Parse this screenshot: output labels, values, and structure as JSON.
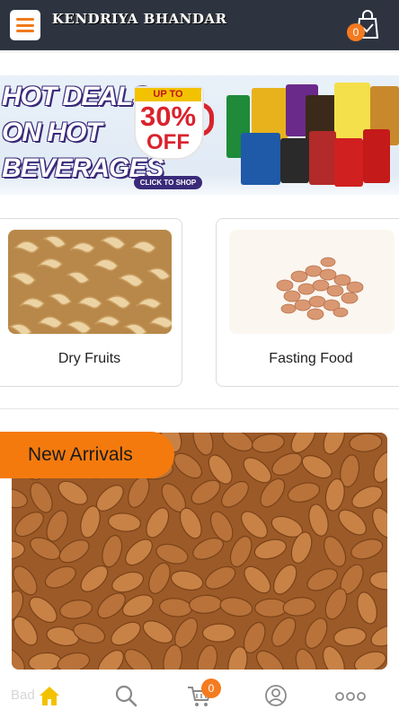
{
  "header": {
    "brand": "KENDRIYA BHANDAR",
    "cart_count": "0"
  },
  "banner": {
    "headline": [
      "HOT DEALS",
      "ON HOT",
      "BEVERAGES"
    ],
    "upto": "UP TO",
    "percent": "30%",
    "off": "OFF",
    "cta": "CLICK TO SHOP"
  },
  "categories": [
    {
      "label": "Dry Fruits"
    },
    {
      "label": "Fasting Food"
    }
  ],
  "new_arrivals": {
    "label": "New Arrivals"
  },
  "bottom_nav": {
    "ghost_text": "Bad",
    "cart_count": "0",
    "items": [
      "home-icon",
      "search-icon",
      "cart-icon",
      "user-icon",
      "more-icon"
    ]
  },
  "colors": {
    "header_bg": "#2d3440",
    "accent": "#f47a0e",
    "badge": "#f47b20",
    "home_icon": "#f2c200"
  }
}
